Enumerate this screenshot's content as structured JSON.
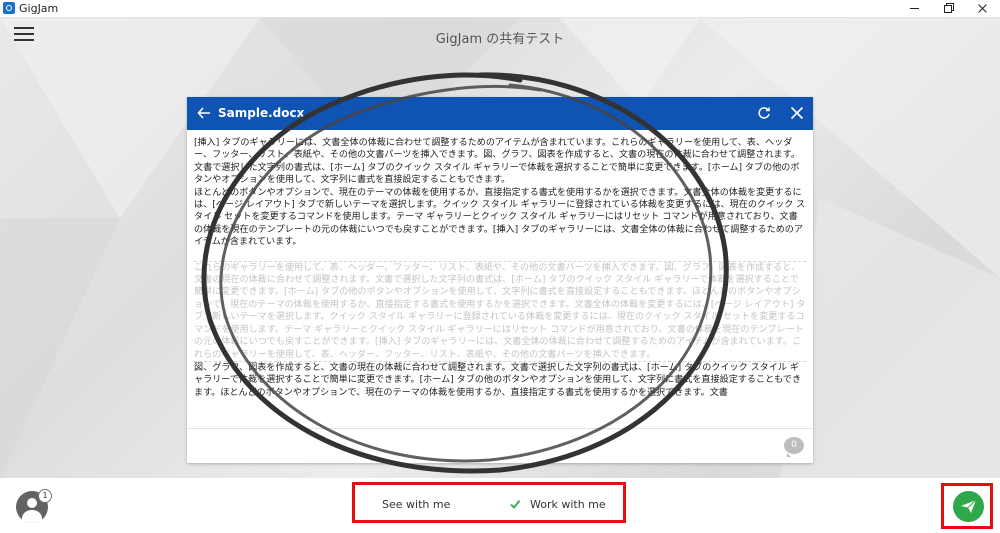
{
  "app": {
    "name": "GigJam",
    "window_title": "GigJam の共有テスト"
  },
  "document": {
    "title": "Sample.docx",
    "paragraphs": [
      "[挿入] タブのギャラリーには、文書全体の体裁に合わせて調整するためのアイテムが含まれています。これらのギャラリーを使用して、表、ヘッダー、フッター、リスト、表紙や、その他の文書パーツを挿入できます。図、グラフ、図表を作成すると、文書の現在の体裁に合わせて調整されます。文書で選択した文字列の書式は、[ホーム] タブのクイック スタイル ギャラリーで体裁を選択することで簡単に変更できます。[ホーム] タブの他のボタンやオプションを使用して、文字列に書式を直接設定することもできます。",
      "ほとんどのボタンやオプションで、現在のテーマの体裁を使用するか、直接指定する書式を使用するかを選択できます。文書全体の体裁を変更するには、[ページ レイアウト] タブで新しいテーマを選択します。クイック スタイル ギャラリーに登録されている体裁を変更するには、現在のクイック スタイル セットを変更するコマンドを使用します。テーマ ギャラリーとクイック スタイル ギャラリーにはリセット コマンドが用意されており、文書の体裁を現在のテンプレートの元の体裁にいつでも戻すことができます。[挿入] タブのギャラリーには、文書全体の体裁に合わせて調整するためのアイテムが含まれています。",
      "これらのギャラリーを使用して、表、ヘッダー、フッター、リスト、表紙や、その他の文書パーツを挿入できます。図、グラフ、図表を作成すると、文書の現在の体裁に合わせて調整されます。文書で選択した文字列の書式は、[ホーム] タブのクイック スタイル ギャラリーで体裁を選択することで簡単に変更できます。[ホーム] タブの他のボタンやオプションを使用して、文字列に書式を直接設定することもできます。ほとんどのボタンやオプションで、現在のテーマの体裁を使用するか、直接指定する書式を使用するかを選択できます。文書全体の体裁を変更するには、[ページ レイアウト] タブで新しいテーマを選択します。クイック スタイル ギャラリーに登録されている体裁を変更するには、現在のクイック スタイル セットを変更するコマンドを使用します。テーマ ギャラリーとクイック スタイル ギャラリーにはリセット コマンドが用意されており、文書の体裁を現在のテンプレートの元の体裁にいつでも戻すことができます。[挿入] タブのギャラリーには、文書全体の体裁に合わせて調整するためのアイテムが含まれています。これらのギャラリーを使用して、表、ヘッダー、フッター、リスト、表紙や、その他の文書パーツを挿入できます。",
      "図、グラフ、図表を作成すると、文書の現在の体裁に合わせて調整されます。文書で選択した文字列の書式は、[ホーム] タブのクイック スタイル ギャラリーで体裁を選択することで簡単に変更できます。[ホーム] タブの他のボタンやオプションを使用して、文字列に書式を直接設定することもできます。ほとんどのボタンやオプションで、現在のテーマの体裁を使用するか、直接指定する書式を使用するかを選択できます。文書"
    ],
    "comment_count": "0"
  },
  "participants": {
    "count": "1"
  },
  "modes": {
    "see": "See with me",
    "work": "Work with me",
    "selected": "work"
  },
  "colors": {
    "header_blue": "#0f53b3",
    "highlight_red": "#e01010",
    "send_green": "#2ea84a",
    "check_green": "#2ea84a"
  },
  "icons": {
    "menu": "hamburger-icon",
    "back": "arrow-left-icon",
    "refresh": "refresh-icon",
    "close": "close-icon",
    "comment": "comment-icon",
    "user": "user-icon",
    "check": "check-icon",
    "send": "send-icon"
  }
}
